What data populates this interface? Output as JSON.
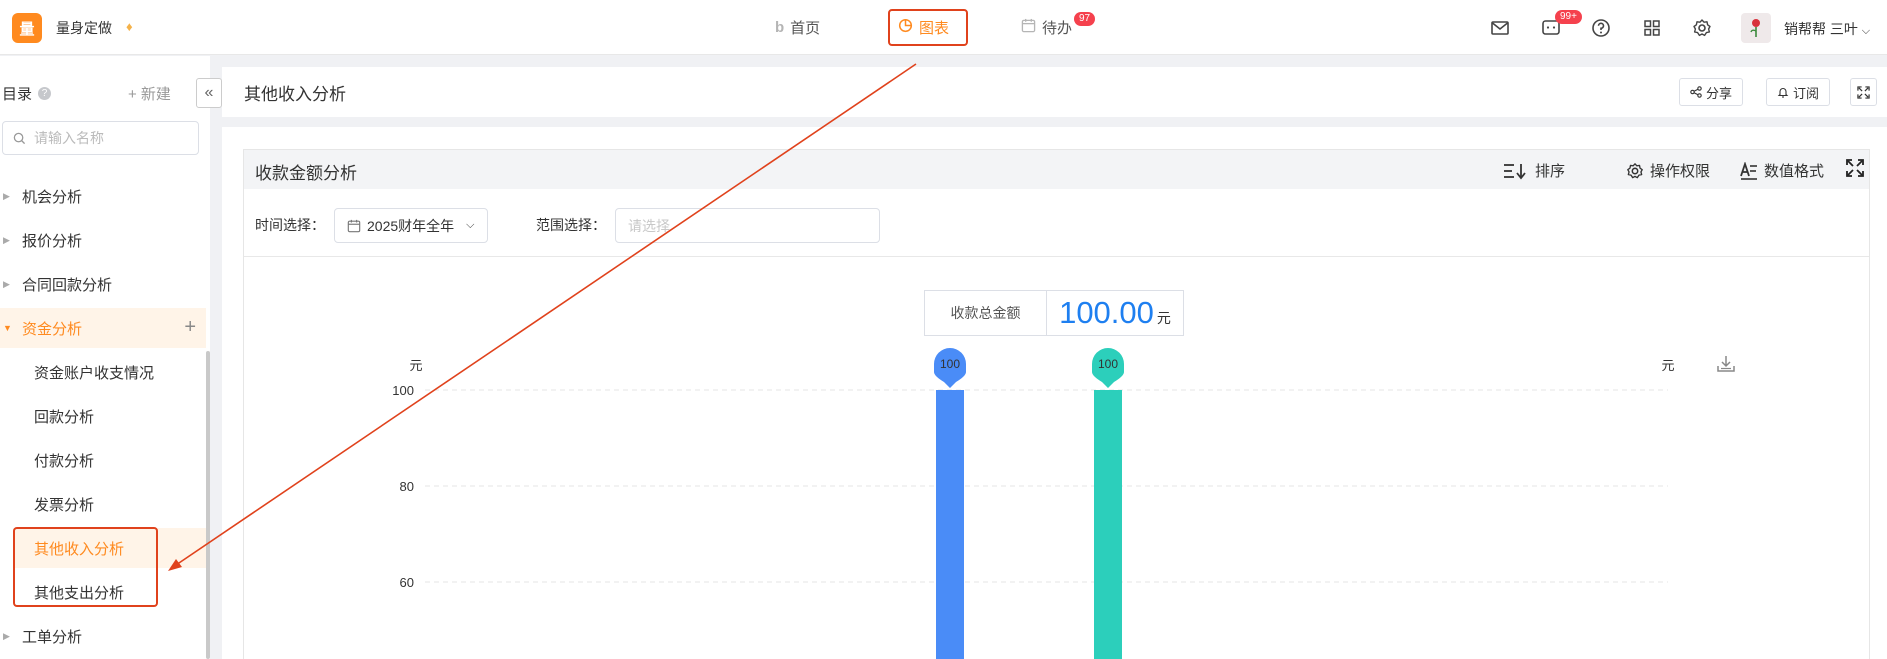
{
  "app": {
    "logo_char": "量",
    "name": "量身定做"
  },
  "nav": {
    "items": [
      {
        "label": "首页",
        "icon": "b-logo-icon"
      },
      {
        "label": "图表",
        "icon": "pie-chart-icon",
        "active": true
      },
      {
        "label": "待办",
        "icon": "calendar-icon",
        "badge": "97"
      }
    ]
  },
  "topbar": {
    "chat_badge": "99+",
    "user_name": "销帮帮 三叶"
  },
  "sidebar": {
    "title": "目录",
    "new_label": "+ 新建",
    "search_placeholder": "请输入名称",
    "groups": [
      {
        "label": "机会分析"
      },
      {
        "label": "报价分析"
      },
      {
        "label": "合同回款分析"
      },
      {
        "label": "资金分析",
        "open": true,
        "children": [
          "资金账户收支情况",
          "回款分析",
          "付款分析",
          "发票分析",
          "其他收入分析",
          "其他支出分析"
        ]
      },
      {
        "label": "工单分析"
      }
    ],
    "active_child": "其他收入分析"
  },
  "header": {
    "page_title": "其他收入分析",
    "share_label": "分享",
    "subscribe_label": "订阅"
  },
  "card": {
    "title": "收款金额分析",
    "tools": {
      "sort": "排序",
      "permission": "操作权限",
      "format": "数值格式"
    },
    "filters": {
      "time_label": "时间选择：",
      "time_value": "2025财年全年",
      "range_label": "范围选择：",
      "range_placeholder": "请选择"
    },
    "total": {
      "label": "收款总金额",
      "value": "100.00",
      "unit": "元"
    }
  },
  "colors": {
    "accent": "#ff8a1f",
    "bar1": "#4a8cf7",
    "bar2": "#2ccfbb",
    "annotation": "#e0421c"
  },
  "chart_data": {
    "type": "bar",
    "y_unit_left": "元",
    "y_unit_right": "元",
    "yticks": [
      60,
      80,
      100
    ],
    "ylim": [
      0,
      100
    ],
    "grid": true,
    "series": [
      {
        "values": [
          100
        ],
        "color": "#4a8cf7",
        "label": "100"
      },
      {
        "values": [
          100
        ],
        "color": "#2ccfbb",
        "label": "100"
      }
    ]
  }
}
